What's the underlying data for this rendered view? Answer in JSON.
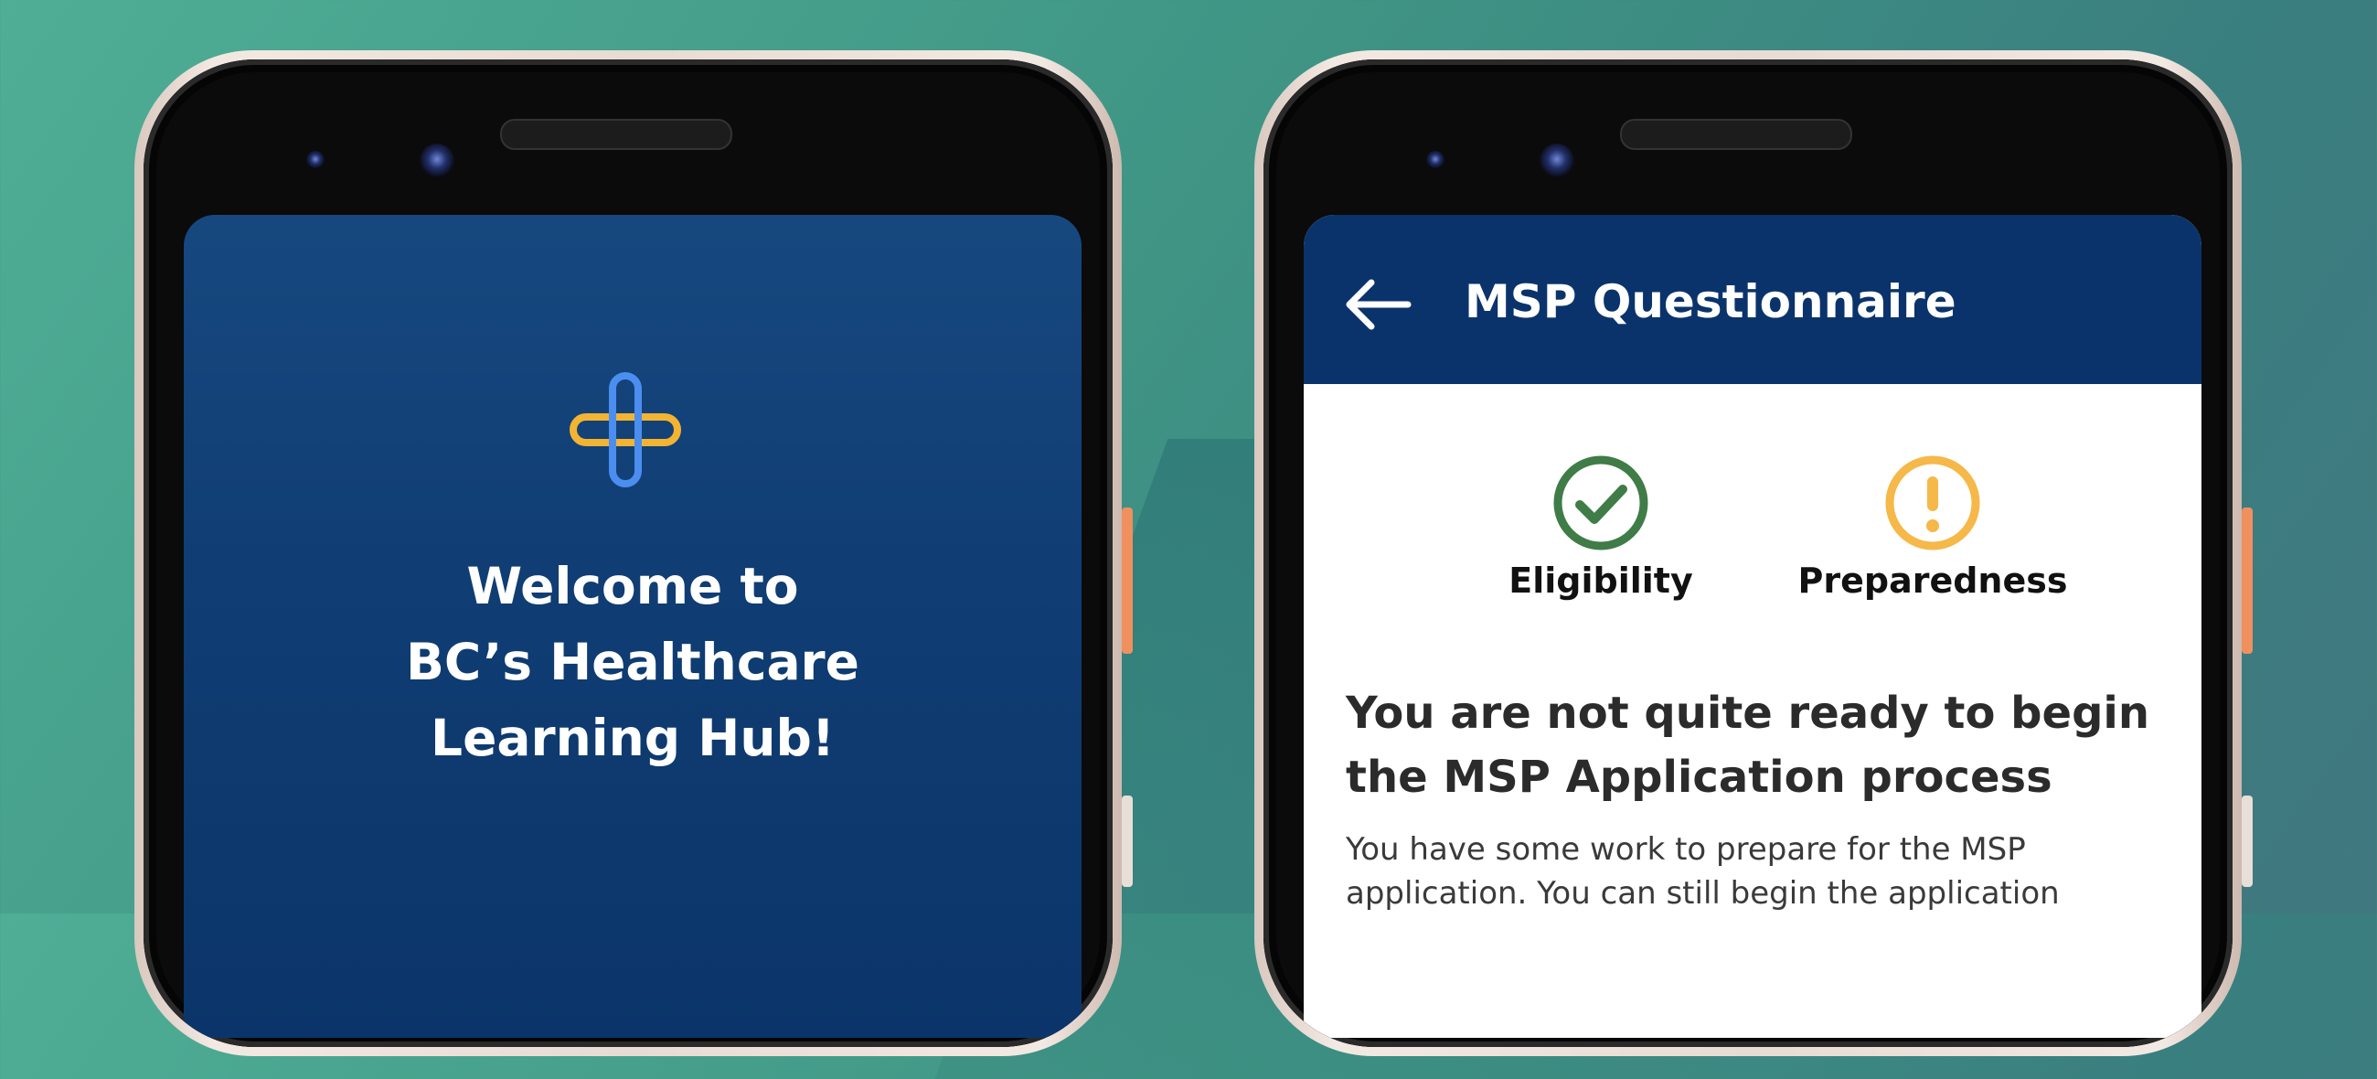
{
  "colors": {
    "brand_blue": "#0b336b",
    "logo_yellow": "#f3b432",
    "logo_blue": "#4b8ef0",
    "success_green": "#3f7c47",
    "warning_yellow": "#f5b849"
  },
  "welcome_screen": {
    "logo_icon": "health-cross-icon",
    "title_line1": "Welcome to",
    "title_line2": "BC’s Healthcare",
    "title_line3": "Learning Hub!"
  },
  "quiz_screen": {
    "back_icon": "arrow-left-icon",
    "title": "MSP Questionnaire",
    "statuses": [
      {
        "label": "Eligibility",
        "icon": "check-circle-icon",
        "state": "complete"
      },
      {
        "label": "Preparedness",
        "icon": "exclamation-circle-icon",
        "state": "warning"
      }
    ],
    "heading": "You are not quite ready to begin the MSP Application process",
    "body": "You have some work to prepare for the MSP application. You can still begin the application"
  }
}
